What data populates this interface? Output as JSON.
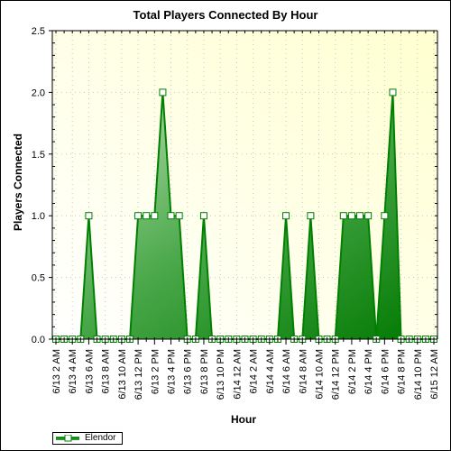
{
  "chart_data": {
    "type": "area",
    "title": "Total Players Connected By Hour",
    "xlabel": "Hour",
    "ylabel": "Players Connected",
    "ylim": [
      0,
      2.5
    ],
    "yticks": [
      "0.0",
      "0.5",
      "1.0",
      "1.5",
      "2.0",
      "2.5"
    ],
    "ytick_values": [
      0,
      0.5,
      1.0,
      1.5,
      2.0,
      2.5
    ],
    "xtick_labels": [
      "6/13 2 AM",
      "6/13 4 AM",
      "6/13 6 AM",
      "6/13 8 AM",
      "6/13 10 AM",
      "6/13 12 PM",
      "6/13 2 PM",
      "6/13 4 PM",
      "6/13 6 PM",
      "6/13 8 PM",
      "6/13 10 PM",
      "6/14 12 AM",
      "6/14 2 AM",
      "6/14 4 AM",
      "6/14 6 AM",
      "6/14 8 AM",
      "6/14 10 AM",
      "6/14 12 PM",
      "6/14 2 PM",
      "6/14 4 PM",
      "6/14 6 PM",
      "6/14 8 PM",
      "6/14 10 PM",
      "6/15 12 AM"
    ],
    "x_start": "6/13 2 AM",
    "x_step": "1 hour",
    "grid": true,
    "legend_position": "bottom-left",
    "series": [
      {
        "name": "Elendor",
        "values": [
          0,
          0,
          0,
          0,
          1,
          0,
          0,
          0,
          0,
          0,
          1,
          1,
          1,
          2,
          1,
          1,
          0,
          0,
          1,
          0,
          0,
          0,
          0,
          0,
          0,
          0,
          0,
          0,
          1,
          0,
          0,
          1,
          0,
          0,
          0,
          1,
          1,
          1,
          1,
          0,
          1,
          2,
          0,
          0,
          0,
          0,
          0
        ]
      }
    ]
  },
  "colors": {
    "line": "#008000",
    "fill_light": "#b8dcb0",
    "fill_dark": "#007a00",
    "plot_bg": "#ffffe6",
    "marker_fill": "#ffffff"
  }
}
